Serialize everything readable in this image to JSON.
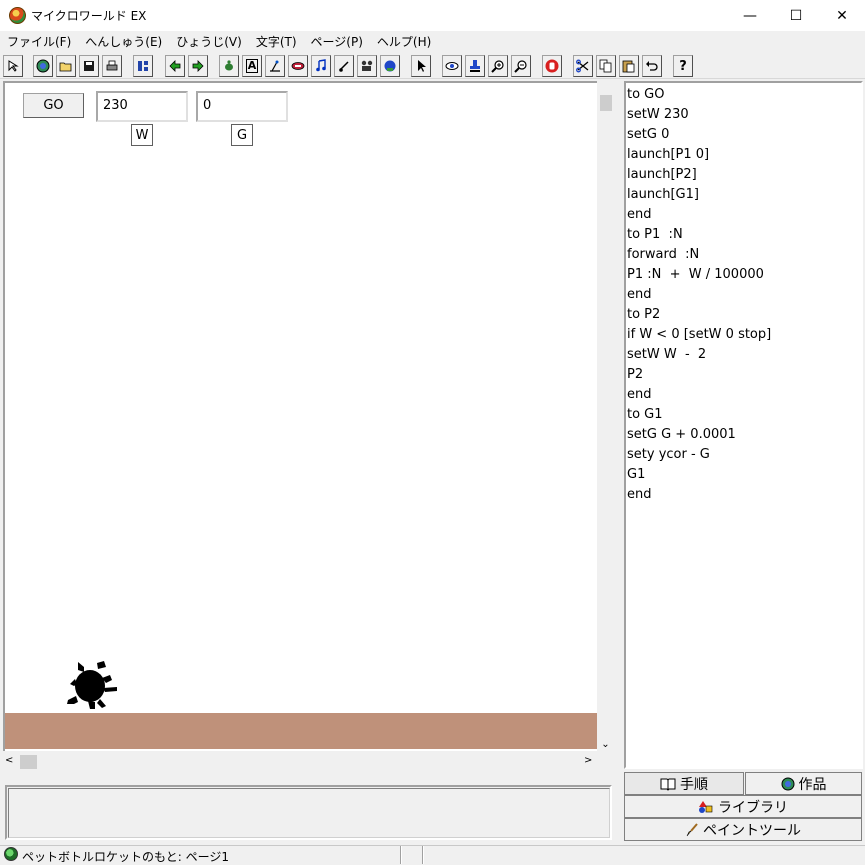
{
  "window": {
    "title": "マイクロワールド EX",
    "minimize": "—",
    "maximize": "☐",
    "close": "✕"
  },
  "menu": [
    "ファイル(F)",
    "へんしゅう(E)",
    "ひょうじ(V)",
    "文字(T)",
    "ページ(P)",
    "ヘルプ(H)"
  ],
  "toolbar": {
    "icons": [
      "pointer-small-icon",
      "globe-icon",
      "open-folder-icon",
      "save-icon",
      "print-icon",
      "page-sorter-icon",
      "left-arrow-icon",
      "right-arrow-icon",
      "new-turtle-icon",
      "text-box-icon",
      "slider-icon",
      "button-icon",
      "music-icon",
      "melody-icon",
      "video-icon",
      "record-icon",
      "select-arrow-icon",
      "eye-icon",
      "stamp-icon",
      "zoom-in-icon",
      "zoom-out-icon",
      "stop-hand-icon",
      "cut-icon",
      "copy-icon",
      "paste-icon",
      "undo-icon",
      "help-icon"
    ],
    "text_icon": "A",
    "help_label": "?"
  },
  "page": {
    "go_button": "GO",
    "w_value": "230",
    "g_value": "0",
    "w_label": "W",
    "g_label": "G"
  },
  "scroll": {
    "up": "▲",
    "down": "⌄",
    "left": "<",
    "right": ">"
  },
  "procedures": [
    "to GO",
    "setW 230",
    "setG 0",
    "launch[P1 0]",
    "launch[P2]",
    "launch[G1]",
    "end",
    "to P1  :N",
    "forward  :N",
    "P1 :N  +  W / 100000",
    "end",
    "to P2",
    "if W < 0 [setW 0 stop]",
    "setW W  -  2",
    "P2",
    "end",
    "to G1",
    "setG G + 0.0001",
    "sety ycor - G",
    "G1",
    "end"
  ],
  "tabs": {
    "procedures": "手順",
    "works": "作品",
    "library": "ライブラリ",
    "paint": "ペイントツール"
  },
  "status": {
    "text": "ペットボトルロケットのもと: ページ1"
  },
  "colors": {
    "ground": "#bf917a",
    "turtle": "#000000"
  }
}
